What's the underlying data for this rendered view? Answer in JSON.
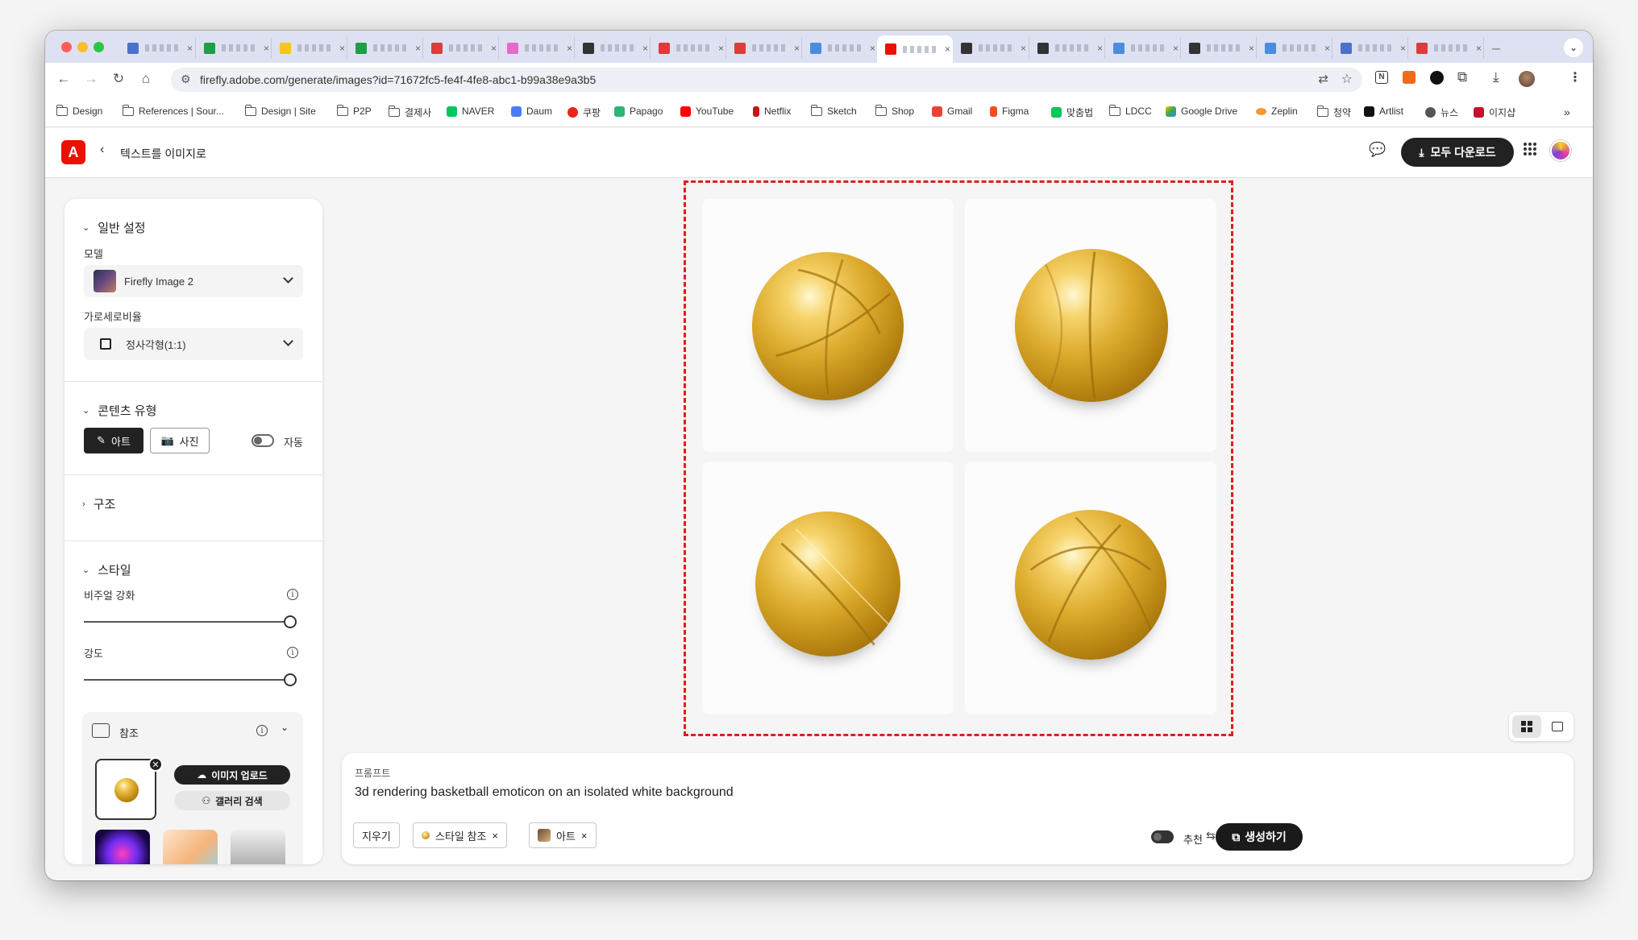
{
  "browser": {
    "url": "firefly.adobe.com/generate/images?id=71672fc5-fe4f-4fe8-abc1-b99a38e9a3b5",
    "tabs_count": 17
  },
  "bookmarks": [
    {
      "label": "Design",
      "icon": "folder-icon"
    },
    {
      "label": "References | Sour...",
      "icon": "folder-icon"
    },
    {
      "label": "Design | Site",
      "icon": "folder-icon"
    },
    {
      "label": "P2P",
      "icon": "folder-icon"
    },
    {
      "label": "결제사",
      "icon": "folder-icon"
    },
    {
      "label": "NAVER",
      "icon": "naver-icon",
      "color": "#03c75a"
    },
    {
      "label": "Daum",
      "icon": "daum-icon",
      "color": "#4a7bf7"
    },
    {
      "label": "쿠팡",
      "icon": "coupang-icon",
      "color": "#e8251c"
    },
    {
      "label": "Papago",
      "icon": "papago-icon",
      "color": "#2bb673"
    },
    {
      "label": "YouTube",
      "icon": "youtube-icon",
      "color": "#ff0000"
    },
    {
      "label": "Netflix",
      "icon": "netflix-icon",
      "color": "#c4161c"
    },
    {
      "label": "Sketch",
      "icon": "folder-icon"
    },
    {
      "label": "Shop",
      "icon": "folder-icon"
    },
    {
      "label": "Gmail",
      "icon": "gmail-icon",
      "color": "#ea4335"
    },
    {
      "label": "Figma",
      "icon": "figma-icon",
      "color": "#f24e1e"
    },
    {
      "label": "맞춤법",
      "icon": "spellcheck-icon",
      "color": "#03c75a"
    },
    {
      "label": "LDCC",
      "icon": "folder-icon"
    },
    {
      "label": "Google Drive",
      "icon": "drive-icon",
      "color": "#34a853"
    },
    {
      "label": "Zeplin",
      "icon": "zeplin-icon",
      "color": "#f69833"
    },
    {
      "label": "청약",
      "icon": "folder-icon"
    },
    {
      "label": "Artlist",
      "icon": "artlist-icon",
      "color": "#111111"
    },
    {
      "label": "뉴스",
      "icon": "news-icon",
      "color": "#555555"
    },
    {
      "label": "이지샵",
      "icon": "shop-icon",
      "color": "#c8102e"
    }
  ],
  "app": {
    "page_title": "텍스트를 이미지로",
    "download_all": "모두 다운로드",
    "brand_color": "#eb1000"
  },
  "sidebar": {
    "general": {
      "title": "일반 설정",
      "model_label": "모델",
      "model_value": "Firefly Image 2",
      "ratio_label": "가로세로비율",
      "ratio_value": "정사각형(1:1)"
    },
    "content_type": {
      "title": "콘텐츠 유형",
      "art": "아트",
      "photo": "사진",
      "auto": "자동"
    },
    "structure": {
      "title": "구조"
    },
    "style": {
      "title": "스타일",
      "visual_label": "비주얼 강화",
      "visual_value": 1.0,
      "strength_label": "강도",
      "strength_value": 1.0,
      "reference_title": "참조",
      "upload": "이미지 업로드",
      "gallery": "갤러리 검색"
    }
  },
  "results": {
    "count": 4,
    "images": [
      "golden-basketball-1",
      "golden-basketball-2",
      "golden-basketball-3",
      "golden-basketball-4"
    ]
  },
  "prompt": {
    "label": "프롬프트",
    "text": "3d rendering basketball emoticon on an isolated white background",
    "clear": "지우기",
    "chip_style": "스타일 참조",
    "chip_art": "아트",
    "recommend": "추천",
    "generate": "생성하기"
  }
}
